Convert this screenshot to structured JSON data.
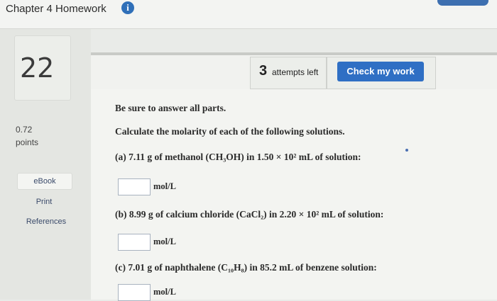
{
  "header": {
    "title": "Chapter 4 Homework",
    "info_icon": "info-icon"
  },
  "question": {
    "number": "22",
    "points_value": "0.72",
    "points_label": "points",
    "attempts_number": "3",
    "attempts_text": "attempts left",
    "check_label": "Check my work"
  },
  "sidebar": {
    "ebook": "eBook",
    "print": "Print",
    "references": "References"
  },
  "body": {
    "intro": "Be sure to answer all parts.",
    "instruction": "Calculate the molarity of each of the following solutions.",
    "part_a": "(a) 7.11 g of methanol (CH₃OH) in 1.50 × 10² mL of solution:",
    "part_b": "(b) 8.99 g of calcium chloride (CaCl₂) in 2.20 × 10² mL of solution:",
    "part_c": "(c) 7.01 g of naphthalene (C₁₀H₈) in 85.2 mL of benzene solution:",
    "unit": "mol/L"
  },
  "answers": {
    "a": "",
    "b": "",
    "c": ""
  },
  "colors": {
    "accent": "#2f6fc4",
    "background": "#e9ebe8"
  }
}
